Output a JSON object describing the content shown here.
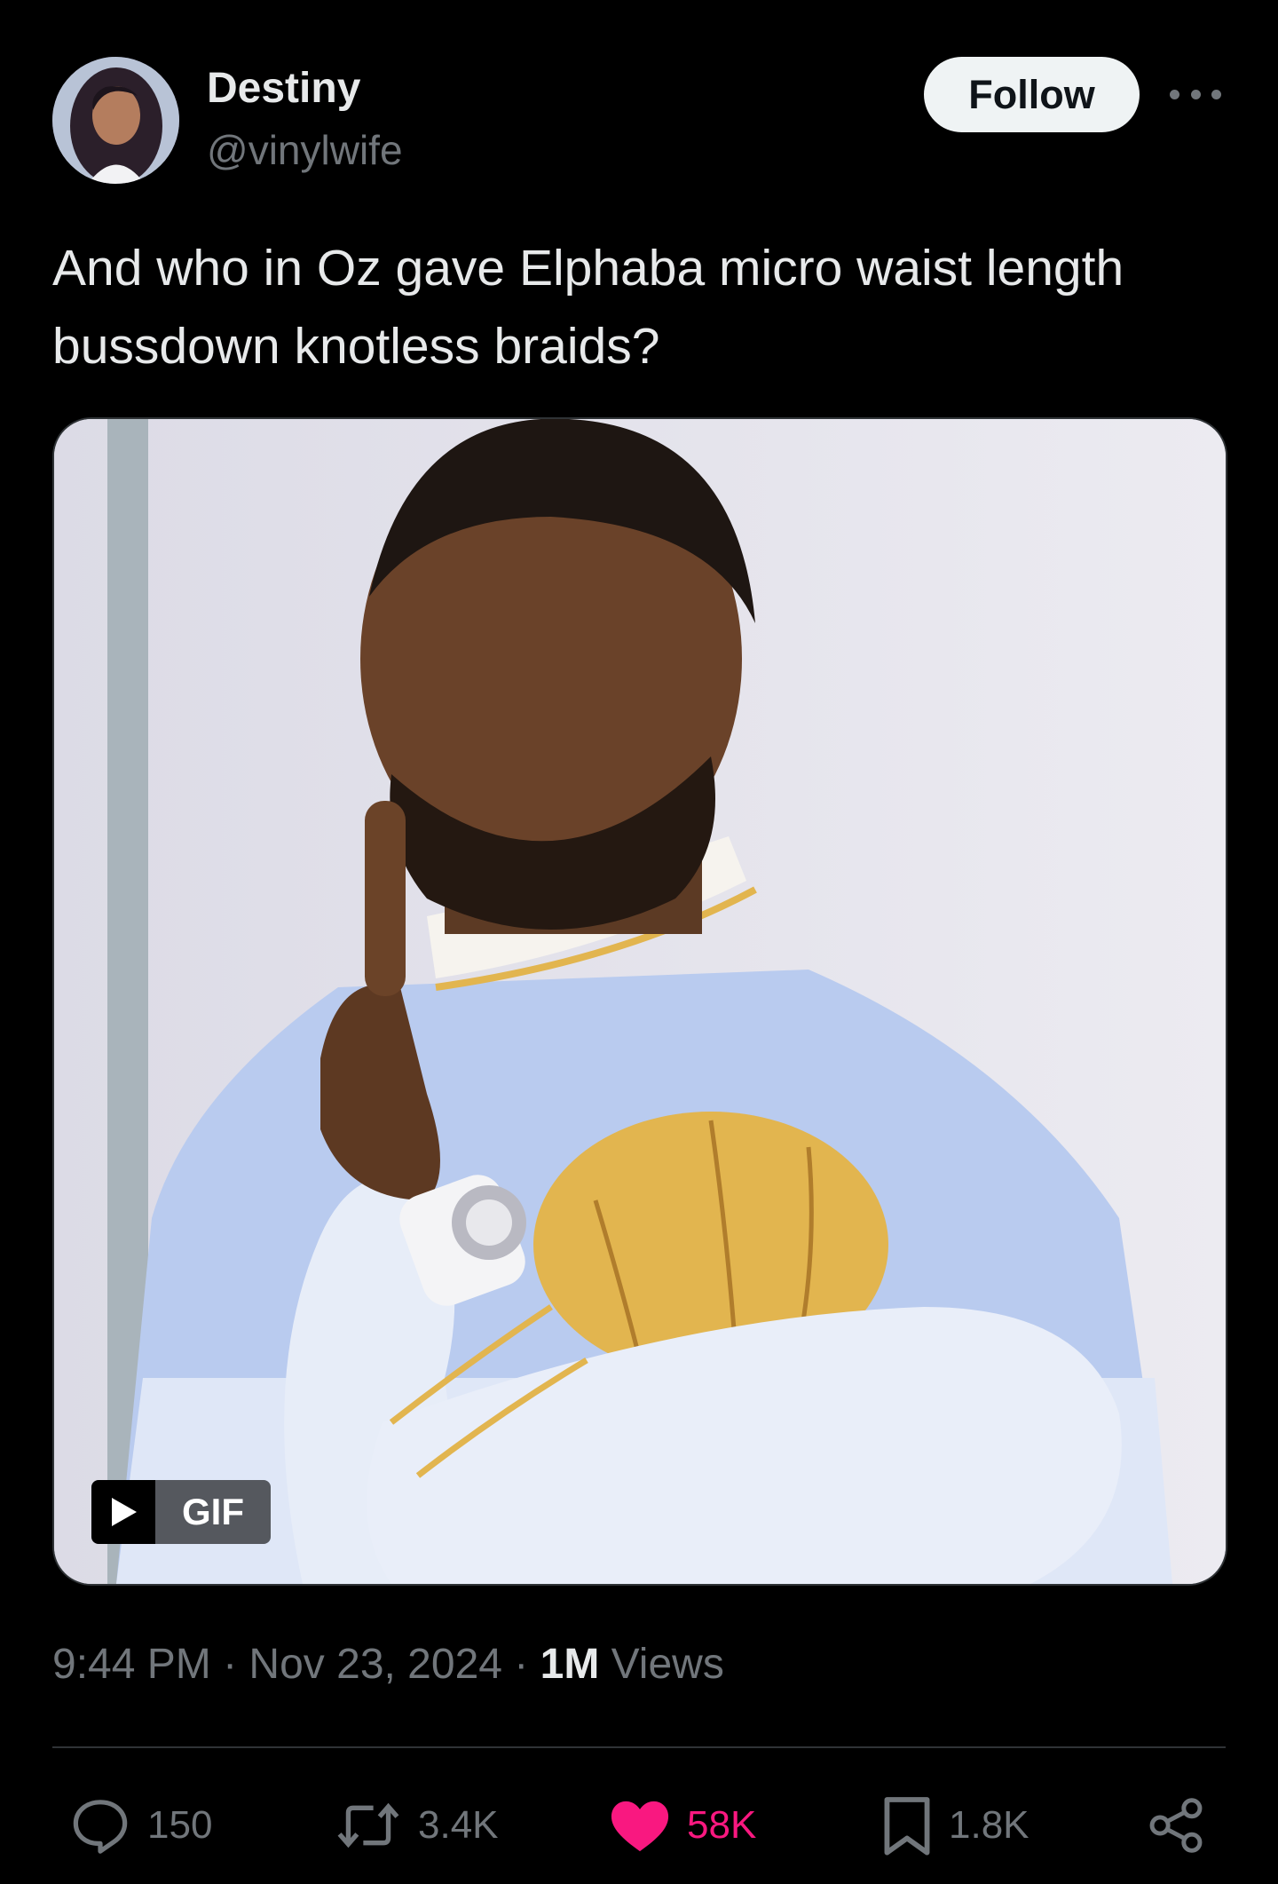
{
  "user": {
    "display_name": "Destiny",
    "handle": "@vinylwife",
    "follow_label": "Follow"
  },
  "tweet": {
    "text": "And who in Oz gave Elphaba micro waist length bussdown knotless braids?",
    "media_badge": "GIF"
  },
  "meta": {
    "time": "9:44 PM",
    "separator": " · ",
    "date": "Nov 23, 2024",
    "views_count": "1M",
    "views_label": "Views"
  },
  "actions": {
    "replies": "150",
    "reposts": "3.4K",
    "likes": "58K",
    "bookmarks": "1.8K"
  },
  "colors": {
    "background": "#000000",
    "text": "#e7e9ea",
    "secondary": "#71767b",
    "like": "#f91880",
    "divider": "#2f3336"
  },
  "icons": [
    "more-icon",
    "play-icon",
    "reply-icon",
    "repost-icon",
    "like-icon",
    "bookmark-icon",
    "share-icon"
  ]
}
